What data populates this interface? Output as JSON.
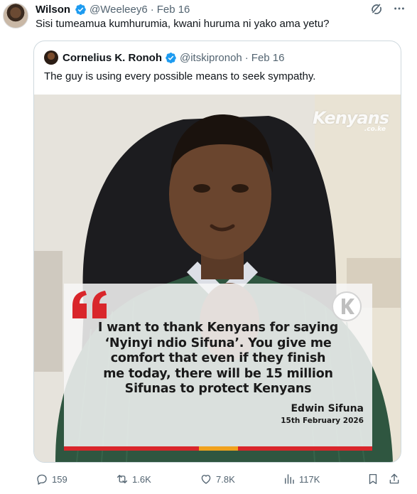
{
  "tweet": {
    "author_name": "Wilson",
    "author_glyph": "",
    "handle": "@Weeleey6",
    "separator": "·",
    "date": "Feb 16",
    "text": "Sisi tumeamua kumhurumia, kwani huruma ni yako ama yetu?"
  },
  "quoted_tweet": {
    "author_name": "Cornelius K. Ronoh",
    "handle": "@itskipronoh",
    "separator": "·",
    "date": "Feb 16",
    "text": "The guy is using every possible means to seek sympathy."
  },
  "media": {
    "watermark": "Kenyans",
    "watermark_suffix": ".co.ke",
    "quote_lines": [
      "I want to thank Kenyans for saying",
      "‘Nyinyi ndio Sifuna’. You give me",
      "comfort that even if they finish",
      "me today, there will be 15 million",
      "Sifunas to protect Kenyans"
    ],
    "quote_author": "Edwin Sifuna",
    "quote_date": "15th February 2026"
  },
  "actions": {
    "replies": "159",
    "reposts": "1.6K",
    "likes": "7.8K",
    "views": "117K"
  },
  "colors": {
    "verified_blue": "#1d9bf0",
    "muted_text": "#536471",
    "quote_mark_red": "#d9262b"
  },
  "icons": [
    "grok-icon",
    "more-icon",
    "verified-icon",
    "reply-icon",
    "repost-icon",
    "like-icon",
    "views-icon",
    "bookmark-icon",
    "share-icon"
  ]
}
